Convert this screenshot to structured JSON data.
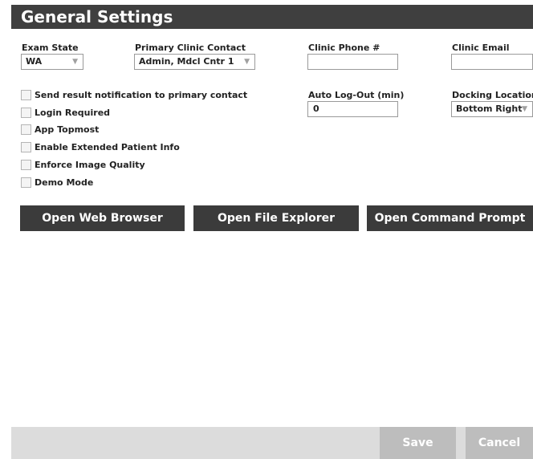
{
  "window": {
    "title": "General Settings"
  },
  "fields": {
    "exam_state": {
      "label": "Exam State",
      "value": "WA"
    },
    "primary_contact": {
      "label": "Primary Clinic Contact",
      "value": "Admin, Mdcl Cntr 1"
    },
    "clinic_phone": {
      "label": "Clinic Phone #",
      "value": ""
    },
    "clinic_email": {
      "label": "Clinic Email",
      "value": ""
    },
    "auto_logout": {
      "label": "Auto Log-Out (min)",
      "value": "0"
    },
    "docking_location": {
      "label": "Docking Location",
      "value": "Bottom Right"
    }
  },
  "checkboxes": [
    {
      "label": "Send result notification to primary contact",
      "checked": false
    },
    {
      "label": "Login Required",
      "checked": false
    },
    {
      "label": "App Topmost",
      "checked": false
    },
    {
      "label": "Enable Extended Patient Info",
      "checked": false
    },
    {
      "label": "Enforce Image Quality",
      "checked": false
    },
    {
      "label": "Demo Mode",
      "checked": false
    }
  ],
  "actions": {
    "open_browser": "Open Web Browser",
    "open_explorer": "Open File Explorer",
    "open_cmd": "Open Command Prompt"
  },
  "footer": {
    "save": "Save",
    "cancel": "Cancel"
  },
  "icons": {
    "dropdown": "▼"
  },
  "colors": {
    "title_bg": "#3f3f3f",
    "button_bg": "#3b3b3b",
    "footer_bg": "#dcdcdc",
    "footer_button_bg": "#bdbdbd"
  }
}
